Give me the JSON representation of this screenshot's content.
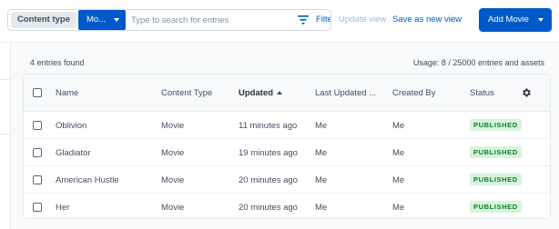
{
  "toolbar": {
    "content_type_label": "Content type",
    "content_type_value": "Mo...",
    "search_placeholder": "Type to search for entries",
    "filter_label": "Filter",
    "update_view_label": "Update view",
    "save_view_label": "Save as new view",
    "add_button_label": "Add Movie"
  },
  "summary": {
    "entries_found": "4 entries found",
    "usage": "Usage: 8 / 25000 entries and assets"
  },
  "table": {
    "headers": {
      "name": "Name",
      "content_type": "Content Type",
      "updated": "Updated",
      "last_updated_by": "Last Updated ...",
      "created_by": "Created By",
      "status": "Status"
    },
    "sort": {
      "column": "updated",
      "direction": "ascending"
    },
    "rows": [
      {
        "name": "Oblivion",
        "content_type": "Movie",
        "updated": "11 minutes ago",
        "last_updated_by": "Me",
        "created_by": "Me",
        "status": "PUBLISHED"
      },
      {
        "name": "Gladiator",
        "content_type": "Movie",
        "updated": "19 minutes ago",
        "last_updated_by": "Me",
        "created_by": "Me",
        "status": "PUBLISHED"
      },
      {
        "name": "American Hustle",
        "content_type": "Movie",
        "updated": "20 minutes ago",
        "last_updated_by": "Me",
        "created_by": "Me",
        "status": "PUBLISHED"
      },
      {
        "name": "Her",
        "content_type": "Movie",
        "updated": "20 minutes ago",
        "last_updated_by": "Me",
        "created_by": "Me",
        "status": "PUBLISHED"
      }
    ]
  },
  "colors": {
    "primary": "#0059c8",
    "status_published_bg": "#d7f4da",
    "status_published_text": "#0d7a33"
  },
  "icons": {
    "filter": "filter-icon",
    "settings": "gear-icon",
    "sort": "sort-ascending-icon",
    "dropdown": "chevron-down-icon"
  }
}
